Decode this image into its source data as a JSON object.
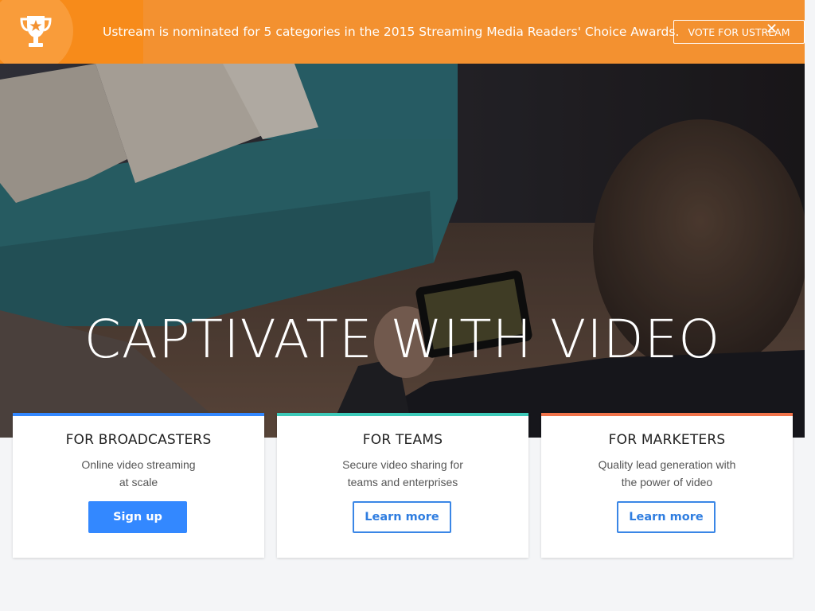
{
  "banner": {
    "text": "Ustream is nominated for 5 categories in the 2015 Streaming Media Readers' Choice Awards.",
    "vote_label": "VOTE FOR USTREAM",
    "close_label": "✕",
    "color": "#f39130"
  },
  "hero": {
    "title": "CAPTIVATE WITH VIDEO"
  },
  "cards": [
    {
      "title": "FOR BROADCASTERS",
      "line1": "Online video streaming",
      "line2": "at scale",
      "button": "Sign up",
      "accent": "#3388ff"
    },
    {
      "title": "FOR TEAMS",
      "line1": "Secure video sharing for",
      "line2": "teams and enterprises",
      "button": "Learn more",
      "accent": "#3cc9b8"
    },
    {
      "title": "FOR MARKETERS",
      "line1": "Quality lead generation with",
      "line2": "the power of video",
      "button": "Learn more",
      "accent": "#f0734a"
    }
  ]
}
